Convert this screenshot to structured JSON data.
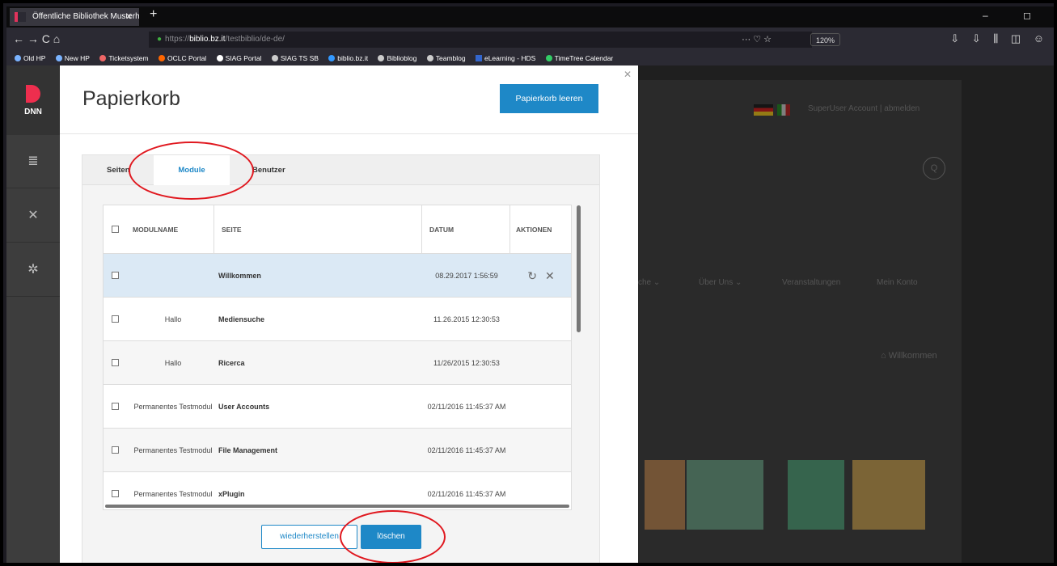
{
  "browser": {
    "tab_title": "Öffentliche Bibliothek Musterh",
    "tab_close": "✕",
    "new_tab": "+",
    "window_controls": "–  ◻",
    "nav_icons": "←  →  C  ⌂",
    "url_prefix": "https://",
    "url_host": "biblio.bz.it",
    "url_path": "/testbiblio/de-de/",
    "zoom": "120%",
    "url_actions": "···  ♡  ☆",
    "right_icons": "⇩ ⇩ ⫼ ◫ ☺",
    "bookmarks": [
      "Old HP",
      "New HP",
      "Ticketsystem",
      "OCLC Portal",
      "SIAG Portal",
      "SIAG TS SB",
      "biblio.bz.it",
      "Biblioblog",
      "Teamblog",
      "eLearning - HDS",
      "TimeTree Calendar"
    ]
  },
  "persona_bar": {
    "logo_text": "DNN",
    "items": [
      {
        "icon": "content-icon",
        "glyph": "≣"
      },
      {
        "icon": "tools-icon",
        "glyph": "✕"
      },
      {
        "icon": "settings-icon",
        "glyph": "✲"
      }
    ]
  },
  "background_site": {
    "account": "SuperUser Account  |  abmelden",
    "search_glyph": "Q",
    "menu": [
      "che ⌄",
      "Über Uns ⌄",
      "Veranstaltungen",
      "Mein Konto"
    ],
    "home": "Willkommen"
  },
  "modal": {
    "close": "✕",
    "title": "Papierkorb",
    "empty_button": "Papierkorb leeren",
    "tabs": [
      "Seiten",
      "Module",
      "Benutzer"
    ],
    "active_tab": "Module",
    "columns": {
      "module_name": "MODULNAME",
      "page": "SEITE",
      "date": "DATUM",
      "actions": "AKTIONEN"
    },
    "rows": [
      {
        "module": "",
        "page": "Willkommen",
        "date": "08.29.2017 1:56:59",
        "restore_glyph": "↻",
        "delete_glyph": "✕"
      },
      {
        "module": "Hallo",
        "page": "Mediensuche",
        "date": "11.26.2015 12:30:53"
      },
      {
        "module": "Hallo",
        "page": "Ricerca",
        "date": "11/26/2015 12:30:53"
      },
      {
        "module": "Permanentes Testmodul",
        "page": "User Accounts",
        "date": "02/11/2016 11:45:37 AM"
      },
      {
        "module": "Permanentes Testmodul",
        "page": "File Management",
        "date": "02/11/2016 11:45:37 AM"
      },
      {
        "module": "Permanentes Testmodul",
        "page": "xPlugin",
        "date": "02/11/2016 11:45:37 AM"
      }
    ],
    "restore_button": "wiederherstellen",
    "delete_button": "löschen"
  },
  "colors": {
    "accent": "#1e88c7",
    "annotation": "#e0181f",
    "selected_row": "#dbe9f5"
  }
}
